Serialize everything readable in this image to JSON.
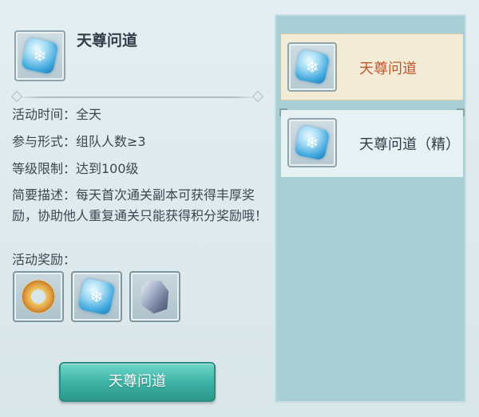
{
  "detail": {
    "title": "天尊问道",
    "icon": "ice-crystal-icon",
    "time": "活动时间：全天",
    "form": "参与形式：组队人数≥3",
    "level": "等级限制：达到100级",
    "desc": "简要描述：每天首次通关副本可获得丰厚奖励，协助他人重复通关只能获得积分奖励哦！",
    "rewards_label": "活动奖励：",
    "rewards": [
      "gold-ring-icon",
      "ice-crystal-icon",
      "ore-stone-icon"
    ],
    "button_label": "天尊问道"
  },
  "list": {
    "items": [
      {
        "label": "天尊问道",
        "icon": "ice-crystal-icon",
        "selected": true
      },
      {
        "label": "天尊问道（精）",
        "icon": "ice-crystal-icon",
        "selected": false
      }
    ]
  },
  "colors": {
    "selected_text": "#c0552f",
    "button": "#3fb5a7",
    "list_bg": "#a9cfd6"
  }
}
